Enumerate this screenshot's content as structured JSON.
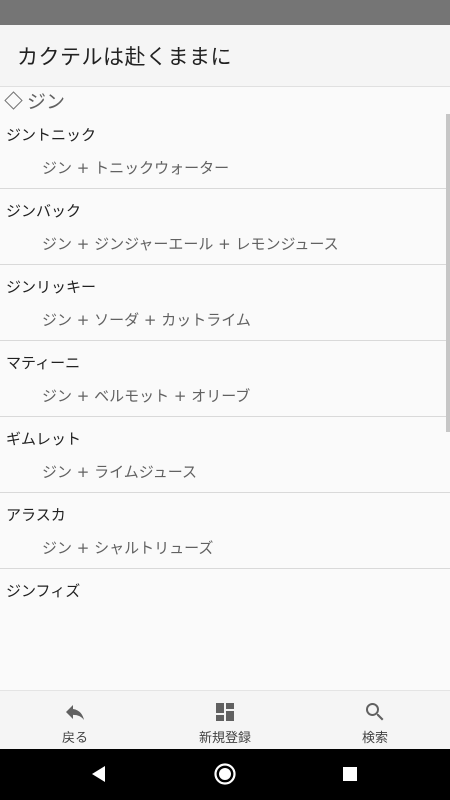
{
  "app": {
    "title": "カクテルは赴くままに"
  },
  "section": {
    "label": "ジン",
    "icon": "diamond-icon"
  },
  "cocktails": [
    {
      "name": "ジントニック",
      "recipe": "ジン + トニックウォーター"
    },
    {
      "name": "ジンバック",
      "recipe": "ジン + ジンジャーエール + レモンジュース"
    },
    {
      "name": "ジンリッキー",
      "recipe": "ジン + ソーダ + カットライム"
    },
    {
      "name": "マティーニ",
      "recipe": "ジン + ベルモット + オリーブ"
    },
    {
      "name": "ギムレット",
      "recipe": "ジン + ライムジュース"
    },
    {
      "name": "アラスカ",
      "recipe": "ジン + シャルトリューズ"
    },
    {
      "name": "ジンフィズ",
      "recipe": ""
    }
  ],
  "bottom_nav": {
    "back": {
      "label": "戻る",
      "icon": "reply-arrow-icon"
    },
    "register": {
      "label": "新規登録",
      "icon": "dashboard-icon"
    },
    "search": {
      "label": "検索",
      "icon": "search-icon"
    }
  },
  "system_nav": {
    "back_icon": "triangle-back-icon",
    "home_icon": "circle-home-icon",
    "recents_icon": "square-recents-icon"
  },
  "colors": {
    "status_bar": "#757575",
    "app_bar": "#f5f5f5",
    "background": "#fafafa",
    "system_nav": "#000000"
  }
}
